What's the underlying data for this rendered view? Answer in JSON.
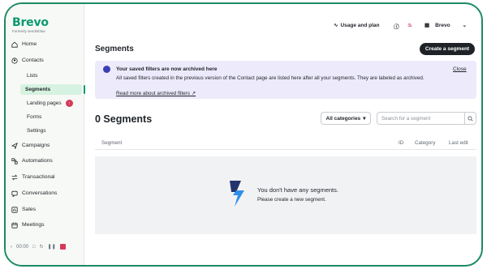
{
  "brand": {
    "name": "Brevo",
    "subtitle": "Formerly sendinblue",
    "accent": "#0b996e"
  },
  "sidebar": {
    "items": [
      {
        "label": "Home",
        "icon": "home-icon"
      },
      {
        "label": "Contacts",
        "icon": "contacts-icon"
      },
      {
        "label": "Campaigns",
        "icon": "send-icon"
      },
      {
        "label": "Automations",
        "icon": "automation-icon"
      },
      {
        "label": "Transactional",
        "icon": "transactional-icon"
      },
      {
        "label": "Conversations",
        "icon": "chat-icon"
      },
      {
        "label": "Sales",
        "icon": "sales-icon"
      },
      {
        "label": "Meetings",
        "icon": "calendar-icon"
      }
    ],
    "contacts_sub": [
      {
        "label": "Lists"
      },
      {
        "label": "Segments",
        "active": true
      },
      {
        "label": "Landing pages",
        "badge": "↑"
      },
      {
        "label": "Forms"
      },
      {
        "label": "Settings"
      }
    ]
  },
  "recorder": {
    "time": "00:00"
  },
  "topbar": {
    "usage_label": "Usage and plan",
    "account_label": "Brevo"
  },
  "page": {
    "title": "Segments",
    "create_button": "Create a segment"
  },
  "banner": {
    "title": "Your saved filters are now archived here",
    "text": "All saved filters created in the previous version of the Contact page are listed here after all your segments. They are labeled as archived.",
    "link": "Read more about archived filters",
    "close": "Close"
  },
  "segments": {
    "count_title": "0 Segments",
    "category_select": "All categories",
    "search_placeholder": "Search for a segment",
    "columns": [
      "Segment",
      "ID",
      "Category",
      "Last edit"
    ],
    "empty_title": "You don't have any segments.",
    "empty_sub": "Please create a new segment."
  }
}
